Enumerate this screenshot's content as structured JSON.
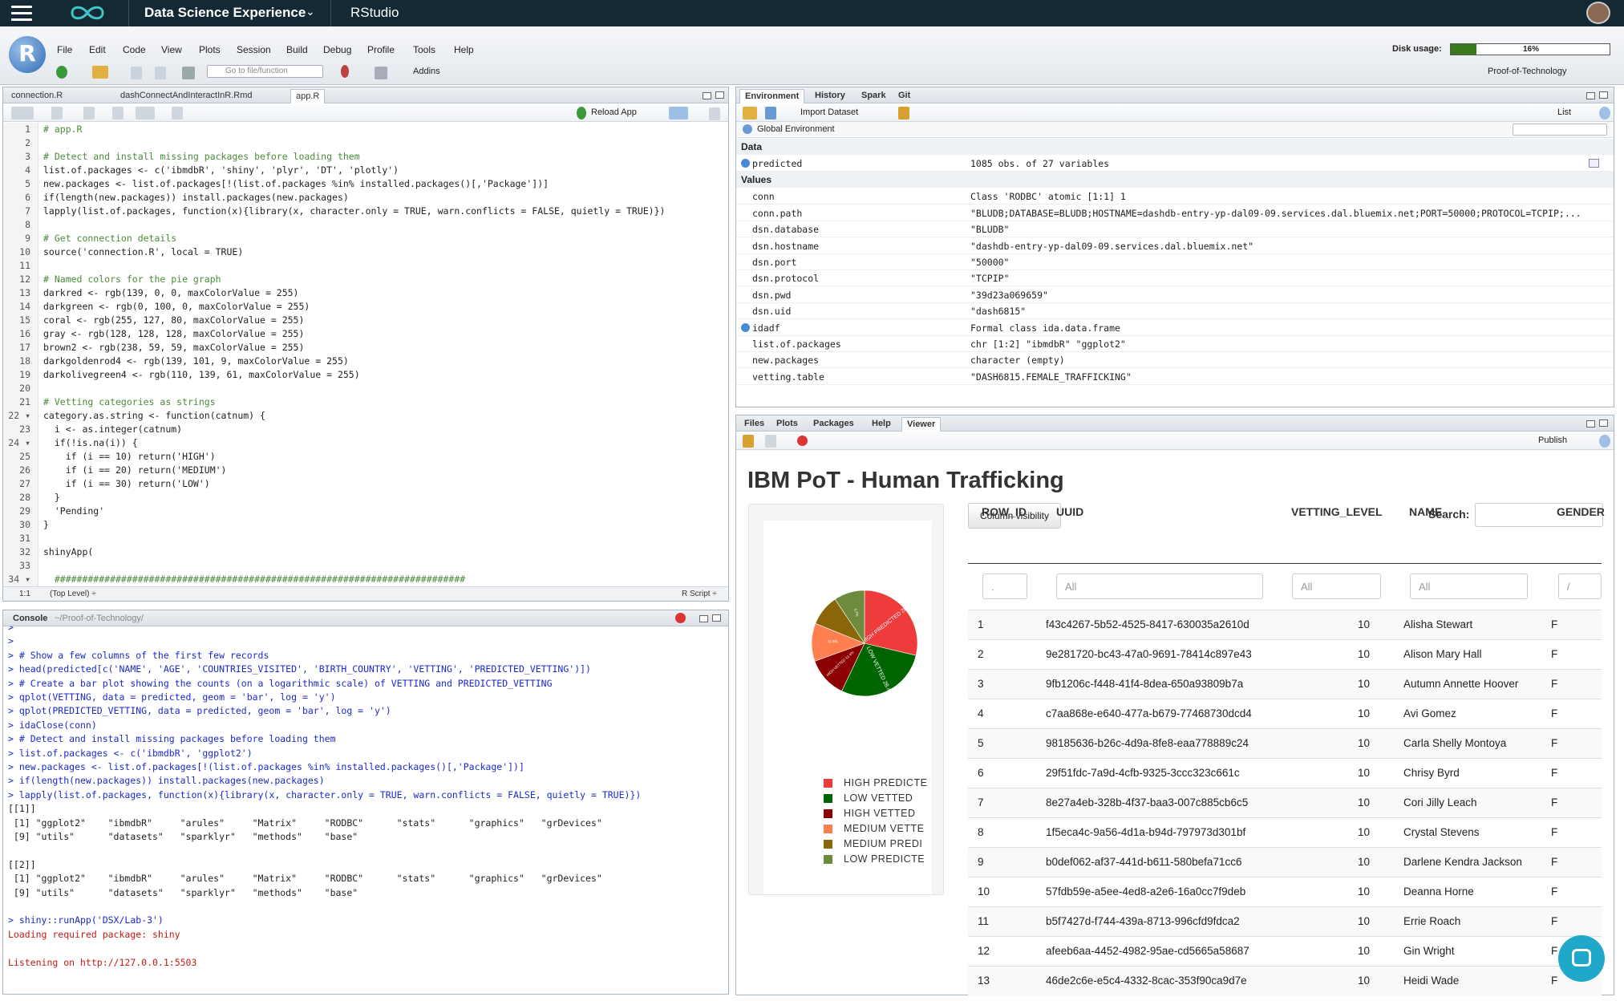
{
  "topbar": {
    "product": "Data Science Experience",
    "app": "RStudio"
  },
  "menu": [
    "File",
    "Edit",
    "Code",
    "View",
    "Plots",
    "Session",
    "Build",
    "Debug",
    "Profile",
    "Tools",
    "Help"
  ],
  "toolbar": {
    "goto": "Go to file/function",
    "addins": "Addins"
  },
  "disk": {
    "label": "Disk usage:",
    "pct": "16%",
    "value": 0.16
  },
  "project": "Proof-of-Technology",
  "editor": {
    "tabs": [
      "connection.R",
      "dashConnectAndInteractInR.Rmd",
      "app.R"
    ],
    "reload": "Reload App",
    "status_pos": "1:1",
    "status_scope": "(Top Level) ÷",
    "status_type": "R Script ÷",
    "lines": [
      {
        "n": "1",
        "t": "# app.R",
        "cls": "com"
      },
      {
        "n": "2",
        "t": ""
      },
      {
        "n": "3",
        "t": "# Detect and install missing packages before loading them",
        "cls": "com"
      },
      {
        "n": "4",
        "t": "list.of.packages <- c('ibmdbR', 'shiny', 'plyr', 'DT', 'plotly')"
      },
      {
        "n": "5",
        "t": "new.packages <- list.of.packages[!(list.of.packages %in% installed.packages()[,'Package'])]"
      },
      {
        "n": "6",
        "t": "if(length(new.packages)) install.packages(new.packages)"
      },
      {
        "n": "7",
        "t": "lapply(list.of.packages, function(x){library(x, character.only = TRUE, warn.conflicts = FALSE, quietly = TRUE)})"
      },
      {
        "n": "8",
        "t": ""
      },
      {
        "n": "9",
        "t": "# Get connection details",
        "cls": "com"
      },
      {
        "n": "10",
        "t": "source('connection.R', local = TRUE)"
      },
      {
        "n": "11",
        "t": ""
      },
      {
        "n": "12",
        "t": "# Named colors for the pie graph",
        "cls": "com"
      },
      {
        "n": "13",
        "t": "darkred <- rgb(139, 0, 0, maxColorValue = 255)"
      },
      {
        "n": "14",
        "t": "darkgreen <- rgb(0, 100, 0, maxColorValue = 255)"
      },
      {
        "n": "15",
        "t": "coral <- rgb(255, 127, 80, maxColorValue = 255)"
      },
      {
        "n": "16",
        "t": "gray <- rgb(128, 128, 128, maxColorValue = 255)"
      },
      {
        "n": "17",
        "t": "brown2 <- rgb(238, 59, 59, maxColorValue = 255)"
      },
      {
        "n": "18",
        "t": "darkgoldenrod4 <- rgb(139, 101, 9, maxColorValue = 255)"
      },
      {
        "n": "19",
        "t": "darkolivegreen4 <- rgb(110, 139, 61, maxColorValue = 255)"
      },
      {
        "n": "20",
        "t": ""
      },
      {
        "n": "21",
        "t": "# Vetting categories as strings",
        "cls": "com"
      },
      {
        "n": "22 ▾",
        "t": "category.as.string <- function(catnum) {"
      },
      {
        "n": "23",
        "t": "  i <- as.integer(catnum)"
      },
      {
        "n": "24 ▾",
        "t": "  if(!is.na(i)) {"
      },
      {
        "n": "25",
        "t": "    if (i == 10) return('HIGH')"
      },
      {
        "n": "26",
        "t": "    if (i == 20) return('MEDIUM')"
      },
      {
        "n": "27",
        "t": "    if (i == 30) return('LOW')"
      },
      {
        "n": "28",
        "t": "  }"
      },
      {
        "n": "29",
        "t": "  'Pending'"
      },
      {
        "n": "30",
        "t": "}"
      },
      {
        "n": "31",
        "t": ""
      },
      {
        "n": "32",
        "t": "shinyApp("
      },
      {
        "n": "33",
        "t": ""
      },
      {
        "n": "34 ▾",
        "t": "  ##########################################################################",
        "cls": "com"
      }
    ]
  },
  "console": {
    "title": "Console",
    "path": "~/Proof-of-Technology/",
    "lines": [
      {
        "t": "> ",
        "cls": "prompt"
      },
      {
        "t": ">",
        "cls": "prompt"
      },
      {
        "t": "> # Show a few columns of the first few records",
        "cls": "prompt"
      },
      {
        "t": "> head(predicted[c('NAME', 'AGE', 'COUNTRIES_VISITED', 'BIRTH_COUNTRY', 'VETTING', 'PREDICTED_VETTING')])",
        "cls": "prompt"
      },
      {
        "t": "> # Create a bar plot showing the counts (on a logarithmic scale) of VETTING and PREDICTED_VETTING",
        "cls": "prompt"
      },
      {
        "t": "> qplot(VETTING, data = predicted, geom = 'bar', log = 'y')",
        "cls": "prompt"
      },
      {
        "t": "> qplot(PREDICTED_VETTING, data = predicted, geom = 'bar', log = 'y')",
        "cls": "prompt"
      },
      {
        "t": "> idaClose(conn)",
        "cls": "prompt"
      },
      {
        "t": "> # Detect and install missing packages before loading them",
        "cls": "prompt"
      },
      {
        "t": "> list.of.packages <- c('ibmdbR', 'ggplot2')",
        "cls": "prompt"
      },
      {
        "t": "> new.packages <- list.of.packages[!(list.of.packages %in% installed.packages()[,'Package'])]",
        "cls": "prompt"
      },
      {
        "t": "> if(length(new.packages)) install.packages(new.packages)",
        "cls": "prompt"
      },
      {
        "t": "> lapply(list.of.packages, function(x){library(x, character.only = TRUE, warn.conflicts = FALSE, quietly = TRUE)})",
        "cls": "prompt"
      },
      {
        "t": "[[1]]",
        "cls": "out"
      },
      {
        "t": " [1] \"ggplot2\"    \"ibmdbR\"     \"arules\"     \"Matrix\"     \"RODBC\"      \"stats\"      \"graphics\"   \"grDevices\"",
        "cls": "out"
      },
      {
        "t": " [9] \"utils\"      \"datasets\"   \"sparklyr\"   \"methods\"    \"base\"",
        "cls": "out"
      },
      {
        "t": "",
        "cls": "out"
      },
      {
        "t": "[[2]]",
        "cls": "out"
      },
      {
        "t": " [1] \"ggplot2\"    \"ibmdbR\"     \"arules\"     \"Matrix\"     \"RODBC\"      \"stats\"      \"graphics\"   \"grDevices\"",
        "cls": "out"
      },
      {
        "t": " [9] \"utils\"      \"datasets\"   \"sparklyr\"   \"methods\"    \"base\"",
        "cls": "out"
      },
      {
        "t": "",
        "cls": "out"
      },
      {
        "t": "> shiny::runApp('DSX/Lab-3')",
        "cls": "prompt"
      },
      {
        "t": "Loading required package: shiny",
        "cls": "red"
      },
      {
        "t": "",
        "cls": "out"
      },
      {
        "t": "Listening on http://127.0.0.1:5503",
        "cls": "red"
      }
    ]
  },
  "env": {
    "tabs": [
      "Environment",
      "History",
      "Spark",
      "Git"
    ],
    "import": "Import Dataset",
    "list": "List",
    "scope": "Global Environment",
    "data_label": "Data",
    "values_label": "Values",
    "rows": [
      {
        "k": "predicted",
        "v": "1085 obs. of 27 variables",
        "sec": "data",
        "icon": true
      },
      {
        "k": "conn",
        "v": "Class 'RODBC'  atomic [1:1] 1"
      },
      {
        "k": "conn.path",
        "v": "\"BLUDB;DATABASE=BLUDB;HOSTNAME=dashdb-entry-yp-dal09-09.services.dal.bluemix.net;PORT=50000;PROTOCOL=TCPIP;..."
      },
      {
        "k": "dsn.database",
        "v": "\"BLUDB\""
      },
      {
        "k": "dsn.hostname",
        "v": "\"dashdb-entry-yp-dal09-09.services.dal.bluemix.net\""
      },
      {
        "k": "dsn.port",
        "v": "\"50000\""
      },
      {
        "k": "dsn.protocol",
        "v": "\"TCPIP\""
      },
      {
        "k": "dsn.pwd",
        "v": "\"39d23a069659\""
      },
      {
        "k": "dsn.uid",
        "v": "\"dash6815\""
      },
      {
        "k": "idadf",
        "v": "Formal class ida.data.frame",
        "icon": true
      },
      {
        "k": "list.of.packages",
        "v": "chr [1:2] \"ibmdbR\" \"ggplot2\""
      },
      {
        "k": "new.packages",
        "v": "character (empty)"
      },
      {
        "k": "vetting.table",
        "v": "\"DASH6815.FEMALE_TRAFFICKING\""
      }
    ]
  },
  "viewer": {
    "tabs": [
      "Files",
      "Plots",
      "Packages",
      "Help",
      "Viewer"
    ],
    "publish": "Publish",
    "title": "IBM PoT - Human Trafficking",
    "colvis": "Column visibility",
    "search": "Search:",
    "columns": [
      "ROW_ID",
      "UUID",
      "VETTING_LEVEL",
      "NAME",
      "GENDER"
    ],
    "filters": [
      ".",
      "All",
      "All",
      "All",
      "/"
    ],
    "rows": [
      [
        "1",
        "f43c4267-5b52-4525-8417-630035a2610d",
        "10",
        "Alisha Stewart",
        "F"
      ],
      [
        "2",
        "9e281720-bc43-47a0-9691-78414c897e43",
        "10",
        "Alison Mary Hall",
        "F"
      ],
      [
        "3",
        "9fb1206c-f448-41f4-8dea-650a93809b7a",
        "10",
        "Autumn Annette Hoover",
        "F"
      ],
      [
        "4",
        "c7aa868e-e640-477a-b679-77468730dcd4",
        "10",
        "Avi Gomez",
        "F"
      ],
      [
        "5",
        "98185636-b26c-4d9a-8fe8-eaa778889c24",
        "10",
        "Carla Shelly Montoya",
        "F"
      ],
      [
        "6",
        "29f51fdc-7a9d-4cfb-9325-3ccc323c661c",
        "10",
        "Chrisy Byrd",
        "F"
      ],
      [
        "7",
        "8e27a4eb-328b-4f37-baa3-007c885cb6c5",
        "10",
        "Cori Jilly Leach",
        "F"
      ],
      [
        "8",
        "1f5eca4c-9a56-4d1a-b94d-797973d301bf",
        "10",
        "Crystal Stevens",
        "F"
      ],
      [
        "9",
        "b0def062-af37-441d-b611-580befa71cc6",
        "10",
        "Darlene Kendra Jackson",
        "F"
      ],
      [
        "10",
        "57fdb59e-a5ee-4ed8-a2e6-16a0cc7f9deb",
        "10",
        "Deanna Horne",
        "F"
      ],
      [
        "11",
        "b5f7427d-f744-439a-8713-996cfd9fdca2",
        "10",
        "Errie Roach",
        "F"
      ],
      [
        "12",
        "afeeb6aa-4452-4982-95ae-cd5665a58687",
        "10",
        "Gin Wright",
        "F"
      ],
      [
        "13",
        "46de2c6e-e5c4-4332-8cac-353f90ca9d7e",
        "10",
        "Heidi Wade",
        "F"
      ]
    ]
  },
  "chart_data": {
    "type": "pie",
    "categories": [
      "HIGH PREDICTED",
      "LOW VETTED",
      "HIGH VETTED",
      "MEDIUM VETTED",
      "MEDIUM PREDICTED",
      "LOW PREDICTED"
    ],
    "values": [
      28.7,
      28.4,
      12.4,
      11.6,
      9.5,
      9.4
    ],
    "slice_labels": [
      "HIGH PREDICTED 28.7%",
      "LOW VETTED 28.4%",
      "HIGH VETTED 12.4%",
      "11.6%",
      "",
      "5.7%"
    ],
    "legend": [
      "HIGH PREDICTE",
      "LOW VETTED",
      "HIGH VETTED",
      "MEDIUM VETTE",
      "MEDIUM PREDI",
      "LOW PREDICTE"
    ],
    "colors": [
      "#ee3b3b",
      "#006400",
      "#8b0000",
      "#ff7f50",
      "#8b6509",
      "#6e8b3d"
    ]
  }
}
